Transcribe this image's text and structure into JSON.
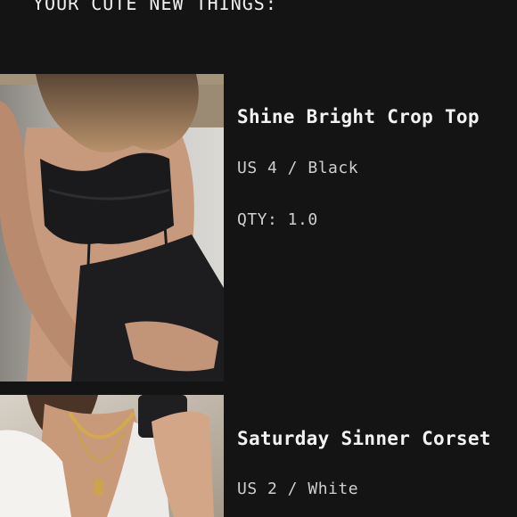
{
  "cart": {
    "heading": "YOUR CUTE NEW THINGS:",
    "items": [
      {
        "name": "Shine Bright Crop Top",
        "variant": "US 4 / Black",
        "qty": "QTY: 1.0",
        "image_icon": "product-photo-black-crop-top"
      },
      {
        "name": "Saturday Sinner Corset",
        "variant": "US 2 / White",
        "image_icon": "product-photo-white-shirt"
      }
    ]
  },
  "colors": {
    "background": "#141414",
    "text": "#e9e9e9"
  }
}
